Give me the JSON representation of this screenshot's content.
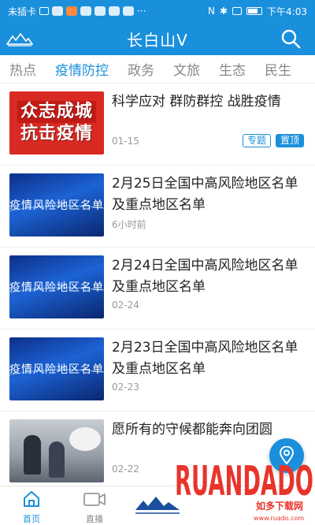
{
  "status_bar": {
    "carrier": "未插卡",
    "time": "下午4:03"
  },
  "header": {
    "title": "长白山V"
  },
  "tabs": [
    {
      "label": "热点",
      "active": false
    },
    {
      "label": "疫情防控",
      "active": true
    },
    {
      "label": "政务",
      "active": false
    },
    {
      "label": "文旅",
      "active": false
    },
    {
      "label": "生态",
      "active": false
    },
    {
      "label": "民生",
      "active": false
    }
  ],
  "news": [
    {
      "title": "科学应对 群防群控 战胜疫情",
      "date": "01-15",
      "tags": [
        "专题",
        "置顶"
      ],
      "thumb": {
        "type": "banner",
        "lines": [
          "众志成城",
          "抗击疫情"
        ]
      }
    },
    {
      "title": "2月25日全国中高风险地区名单及重点地区名单",
      "date": "6小时前",
      "thumb": {
        "type": "blue",
        "text": "疫情风险地区名单"
      }
    },
    {
      "title": "2月24日全国中高风险地区名单及重点地区名单",
      "date": "02-24",
      "thumb": {
        "type": "blue",
        "text": "疫情风险地区名单"
      }
    },
    {
      "title": "2月23日全国中高风险地区名单及重点地区名单",
      "date": "02-23",
      "thumb": {
        "type": "blue",
        "text": "疫情风险地区名单"
      }
    },
    {
      "title": "愿所有的守候都能奔向团圆",
      "date": "02-22",
      "thumb": {
        "type": "photo"
      }
    }
  ],
  "bottom_nav": {
    "home_label": "首页",
    "live_label": "直播"
  },
  "watermark": {
    "brand": "RUANDADO",
    "tagline": "如多下载网",
    "url": "www.ruado.com"
  },
  "colors": {
    "primary": "#1a8fdc",
    "banner_red": "#d82a23",
    "watermark_red": "#e8342b"
  },
  "icons": [
    "search-icon",
    "location-pin-icon",
    "home-icon",
    "video-camera-icon",
    "mountain-logo"
  ]
}
